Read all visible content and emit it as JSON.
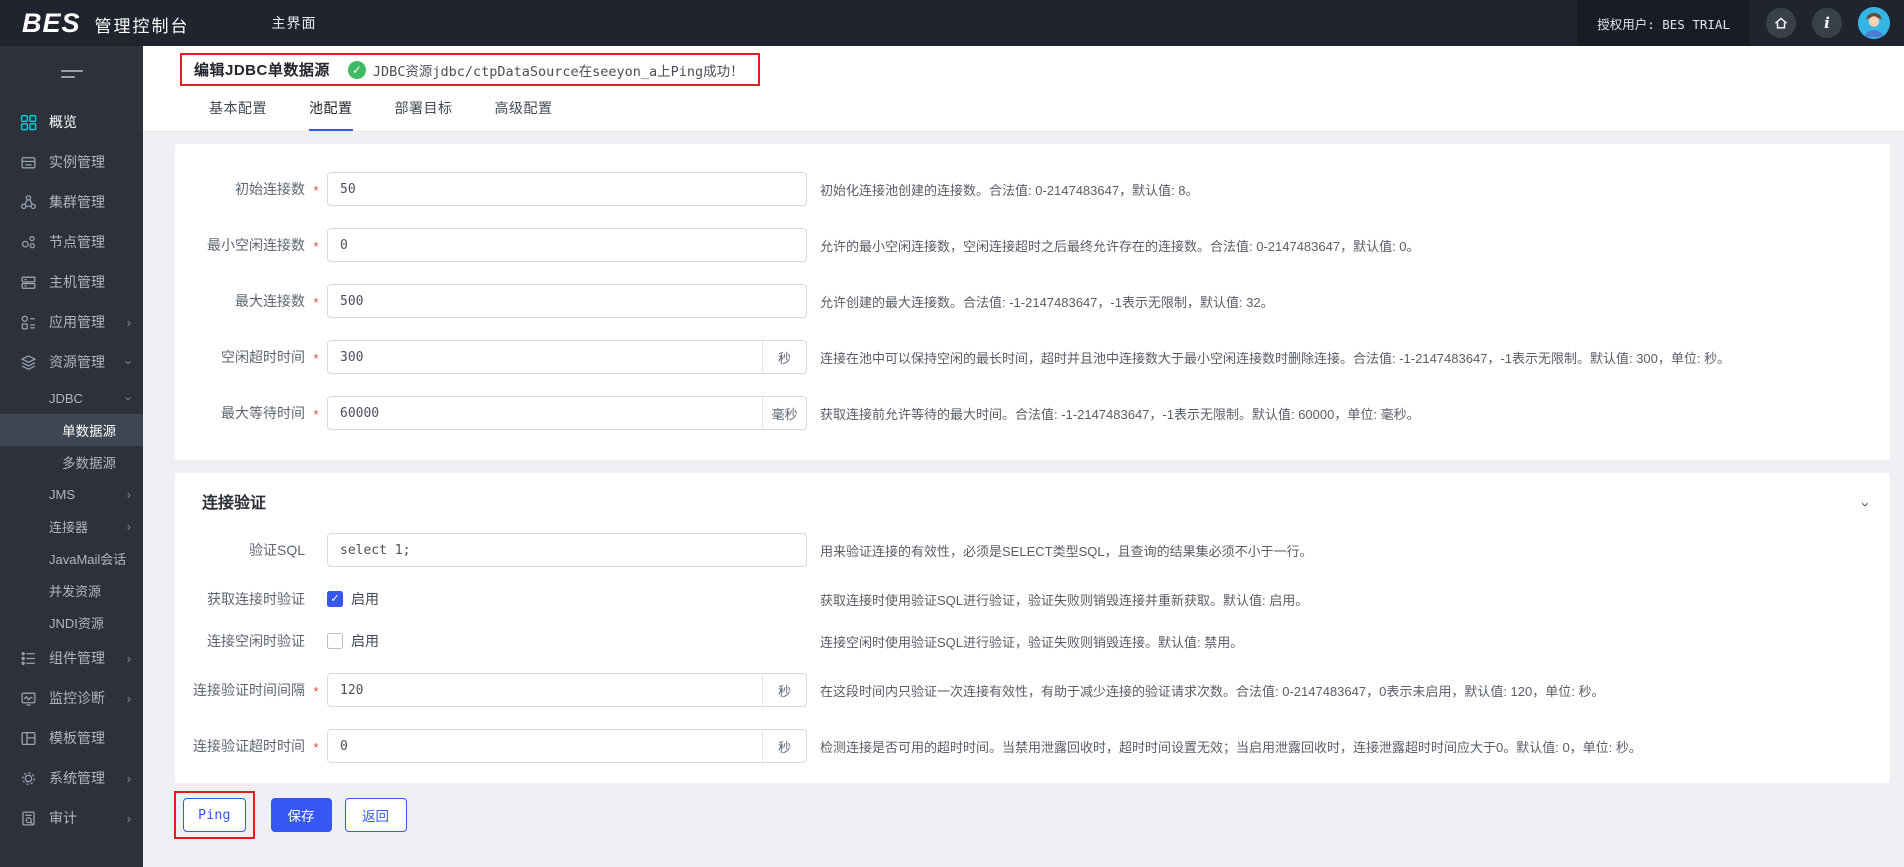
{
  "topbar": {
    "logo": "BES",
    "product_name": "管理控制台",
    "main_nav": "主界面",
    "licensed_user": "授权用户: BES TRIAL"
  },
  "sidebar": {
    "items": [
      {
        "key": "overview",
        "label": "概览",
        "icon": "overview-icon",
        "level": 1,
        "active": true
      },
      {
        "key": "instance-management",
        "label": "实例管理",
        "icon": "instance-icon",
        "level": 1
      },
      {
        "key": "cluster-management",
        "label": "集群管理",
        "icon": "cluster-icon",
        "level": 1
      },
      {
        "key": "node-management",
        "label": "节点管理",
        "icon": "node-icon",
        "level": 1
      },
      {
        "key": "host-management",
        "label": "主机管理",
        "icon": "host-icon",
        "level": 1
      },
      {
        "key": "app-management",
        "label": "应用管理",
        "icon": "app-icon",
        "level": 1,
        "chevron": "right"
      },
      {
        "key": "resource-management",
        "label": "资源管理",
        "icon": "resource-icon",
        "level": 1,
        "chevron": "down"
      },
      {
        "key": "jdbc",
        "label": "JDBC",
        "level": 2,
        "chevron": "down"
      },
      {
        "key": "single-datasource",
        "label": "单数据源",
        "level": 3,
        "selected": true
      },
      {
        "key": "multi-datasource",
        "label": "多数据源",
        "level": 3
      },
      {
        "key": "jms",
        "label": "JMS",
        "level": 2,
        "chevron": "right"
      },
      {
        "key": "connector",
        "label": "连接器",
        "level": 2,
        "chevron": "right"
      },
      {
        "key": "javamail-session",
        "label": "JavaMail会话",
        "level": 2
      },
      {
        "key": "concurrent-resource",
        "label": "并发资源",
        "level": 2
      },
      {
        "key": "jndi-resource",
        "label": "JNDI资源",
        "level": 2
      },
      {
        "key": "component-management",
        "label": "组件管理",
        "icon": "component-icon",
        "level": 1,
        "chevron": "right"
      },
      {
        "key": "monitoring-diagnosis",
        "label": "监控诊断",
        "icon": "monitor-icon",
        "level": 1,
        "chevron": "right"
      },
      {
        "key": "template-management",
        "label": "模板管理",
        "icon": "template-icon",
        "level": 1
      },
      {
        "key": "system-management",
        "label": "系统管理",
        "icon": "system-icon",
        "level": 1,
        "chevron": "right"
      },
      {
        "key": "audit",
        "label": "审计",
        "icon": "audit-icon",
        "level": 1,
        "chevron": "right"
      }
    ]
  },
  "header": {
    "title": "编辑JDBC单数据源",
    "success_message": "JDBC资源jdbc/ctpDataSource在seeyon_a上Ping成功！",
    "tabs": [
      {
        "key": "basic-config",
        "label": "基本配置",
        "active": false
      },
      {
        "key": "pool-config",
        "label": "池配置",
        "active": true
      },
      {
        "key": "deploy-target",
        "label": "部署目标",
        "active": false
      },
      {
        "key": "advanced-config",
        "label": "高级配置",
        "active": false
      }
    ]
  },
  "pool_form": {
    "rows": [
      {
        "key": "initial-connections",
        "label": "初始连接数",
        "required": true,
        "value": "50",
        "unit": "",
        "help": "初始化连接池创建的连接数。合法值: 0-2147483647，默认值: 8。"
      },
      {
        "key": "min-idle-connections",
        "label": "最小空闲连接数",
        "required": true,
        "value": "0",
        "unit": "",
        "help": "允许的最小空闲连接数，空闲连接超时之后最终允许存在的连接数。合法值: 0-2147483647，默认值: 0。"
      },
      {
        "key": "max-connections",
        "label": "最大连接数",
        "required": true,
        "value": "500",
        "unit": "",
        "help": "允许创建的最大连接数。合法值: -1-2147483647，-1表示无限制，默认值: 32。"
      },
      {
        "key": "idle-timeout",
        "label": "空闲超时时间",
        "required": true,
        "value": "300",
        "unit": "秒",
        "help": "连接在池中可以保持空闲的最长时间，超时并且池中连接数大于最小空闲连接数时删除连接。合法值: -1-2147483647，-1表示无限制。默认值: 300，单位: 秒。"
      },
      {
        "key": "max-wait-time",
        "label": "最大等待时间",
        "required": true,
        "value": "60000",
        "unit": "毫秒",
        "help": "获取连接前允许等待的最大时间。合法值: -1-2147483647，-1表示无限制。默认值: 60000，单位: 毫秒。"
      }
    ]
  },
  "validation_section": {
    "title": "连接验证",
    "rows": [
      {
        "key": "validation-sql",
        "type": "input",
        "label": "验证SQL",
        "required": false,
        "value": "select 1;",
        "unit": "",
        "help": "用来验证连接的有效性，必须是SELECT类型SQL，且查询的结果集必须不小于一行。"
      },
      {
        "key": "validate-on-acquire",
        "type": "checkbox",
        "label": "获取连接时验证",
        "checked": true,
        "checkbox_label": "启用",
        "help": "获取连接时使用验证SQL进行验证，验证失败则销毁连接并重新获取。默认值: 启用。"
      },
      {
        "key": "validate-on-idle",
        "type": "checkbox",
        "label": "连接空闲时验证",
        "checked": false,
        "checkbox_label": "启用",
        "help": "连接空闲时使用验证SQL进行验证，验证失败则销毁连接。默认值: 禁用。"
      },
      {
        "key": "validation-interval",
        "type": "input",
        "label": "连接验证时间间隔",
        "required": true,
        "value": "120",
        "unit": "秒",
        "help": "在这段时间内只验证一次连接有效性，有助于减少连接的验证请求次数。合法值: 0-2147483647，0表示未启用，默认值: 120，单位: 秒。"
      },
      {
        "key": "validation-timeout",
        "type": "input",
        "label": "连接验证超时时间",
        "required": true,
        "value": "0",
        "unit": "秒",
        "help": "检测连接是否可用的超时时间。当禁用泄露回收时，超时时间设置无效；当启用泄露回收时，连接泄露超时时间应大于0。默认值: 0，单位: 秒。"
      }
    ]
  },
  "actions": {
    "ping": "Ping",
    "save": "保存",
    "back": "返回"
  },
  "colors": {
    "accent_blue": "#3657f5",
    "success_green": "#3eb964",
    "annotation_red": "#e41e1e",
    "sidebar_active_cyan": "#00c9d6"
  }
}
